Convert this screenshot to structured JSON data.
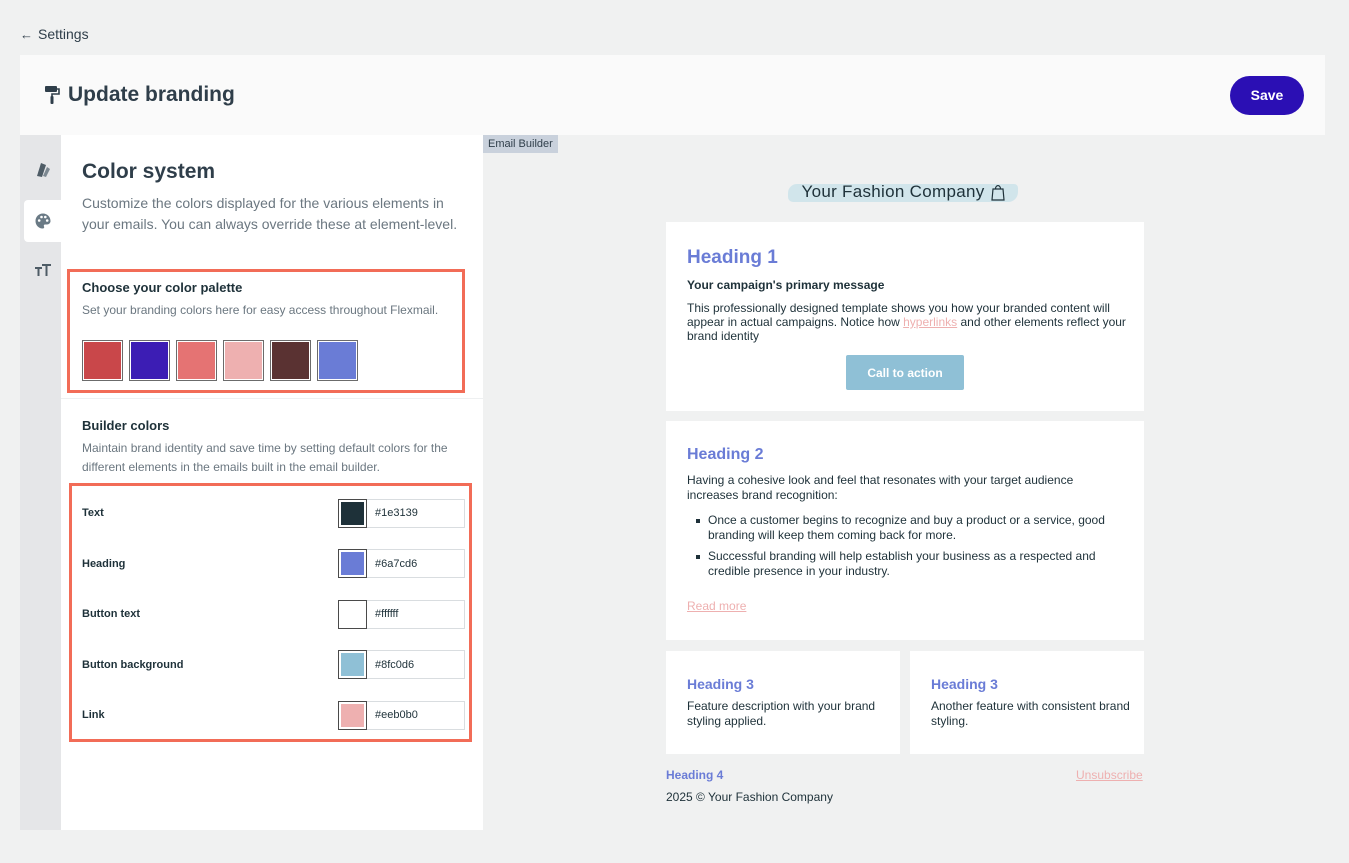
{
  "nav": {
    "back_label": "Settings"
  },
  "header": {
    "title": "Update branding",
    "save_label": "Save"
  },
  "rail": {
    "items": [
      {
        "icon": "paint-swatch-icon"
      },
      {
        "icon": "palette-icon",
        "active": true
      },
      {
        "icon": "typography-icon"
      }
    ]
  },
  "panel": {
    "title": "Color system",
    "description": "Customize the colors displayed for the various elements in your emails. You can always override these at element-level.",
    "palette": {
      "title": "Choose your color palette",
      "description": "Set your branding colors here for easy access throughout Flexmail.",
      "swatches": [
        "#c9474a",
        "#3c1db4",
        "#e57373",
        "#eeb0b0",
        "#5a3232",
        "#6a7cd6"
      ]
    },
    "builder": {
      "title": "Builder colors",
      "description": "Maintain brand identity and save time by setting default colors for the different elements in the emails built in the email builder.",
      "rows": [
        {
          "label": "Text",
          "hex": "#1e3139"
        },
        {
          "label": "Heading",
          "hex": "#6a7cd6"
        },
        {
          "label": "Button text",
          "hex": "#ffffff"
        },
        {
          "label": "Button background",
          "hex": "#8fc0d6"
        },
        {
          "label": "Link",
          "hex": "#eeb0b0"
        }
      ]
    }
  },
  "preview": {
    "tag": "Email Builder",
    "brand_name": "Your Fashion Company",
    "card1": {
      "heading": "Heading 1",
      "subheading": "Your campaign's primary message",
      "body_before": "This professionally designed template shows you how your branded content will appear in actual campaigns. Notice how ",
      "link": "hyperlinks",
      "body_after": " and other elements reflect your brand identity",
      "cta": "Call to action"
    },
    "card2": {
      "heading": "Heading 2",
      "body": "Having a cohesive look and feel that resonates with your target audience increases brand recognition:",
      "bullets": [
        "Once a customer begins to recognize and buy a product or a service, good branding will keep them coming back for more.",
        "Successful branding will help establish your business as a respected and credible presence in your industry."
      ],
      "read_more": "Read more"
    },
    "card3": {
      "heading": "Heading 3",
      "body": "Feature description with your brand styling applied."
    },
    "card4": {
      "heading": "Heading 3",
      "body": "Another feature with consistent brand styling."
    },
    "footer": {
      "heading": "Heading 4",
      "unsubscribe": "Unsubscribe",
      "copyright": "2025 © Your Fashion Company"
    }
  }
}
